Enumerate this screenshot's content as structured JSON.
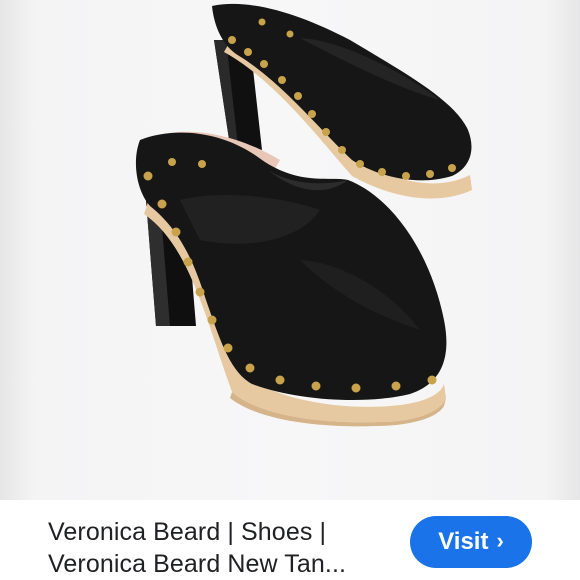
{
  "result": {
    "title_line1": "Veronica Beard | Shoes |",
    "title_line2": "Veronica Beard New Tan...",
    "image_alt": "Black suede studded clog mules with wooden platform"
  },
  "actions": {
    "visit_label": "Visit",
    "visit_icon": "chevron-right-icon"
  },
  "colors": {
    "accent": "#1a73e8",
    "suede": "#141414",
    "wood": "#e6c9a0",
    "stud": "#c9a24c",
    "lining": "#e8c6b8"
  }
}
